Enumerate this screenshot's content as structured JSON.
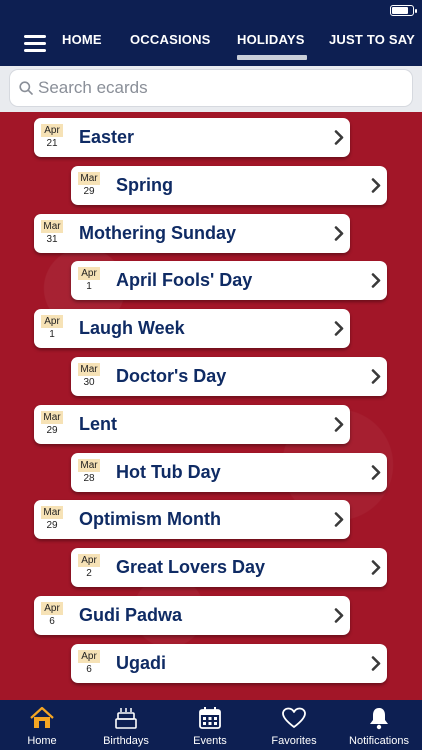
{
  "nav": {
    "tabs": [
      {
        "label": "HOME"
      },
      {
        "label": "OCCASIONS"
      },
      {
        "label": "HOLIDAYS",
        "active": true
      },
      {
        "label": "JUST TO SAY"
      }
    ]
  },
  "status": {
    "battery_level": 0.85
  },
  "search": {
    "placeholder": "Search ecards"
  },
  "cards": [
    {
      "month": "Apr",
      "day": "21",
      "title": "Easter"
    },
    {
      "month": "Mar",
      "day": "29",
      "title": "Spring"
    },
    {
      "month": "Mar",
      "day": "31",
      "title": "Mothering Sunday"
    },
    {
      "month": "Apr",
      "day": "1",
      "title": "April Fools' Day"
    },
    {
      "month": "Apr",
      "day": "1",
      "title": "Laugh Week"
    },
    {
      "month": "Mar",
      "day": "30",
      "title": "Doctor's Day"
    },
    {
      "month": "Mar",
      "day": "29",
      "title": "Lent"
    },
    {
      "month": "Mar",
      "day": "28",
      "title": "Hot Tub Day"
    },
    {
      "month": "Mar",
      "day": "29",
      "title": "Optimism Month"
    },
    {
      "month": "Apr",
      "day": "2",
      "title": "Great Lovers Day"
    },
    {
      "month": "Apr",
      "day": "6",
      "title": "Gudi Padwa"
    },
    {
      "month": "Apr",
      "day": "6",
      "title": "Ugadi"
    }
  ],
  "tabbar": [
    {
      "label": "Home",
      "icon": "home-icon",
      "active": true
    },
    {
      "label": "Birthdays",
      "icon": "cake-icon"
    },
    {
      "label": "Events",
      "icon": "calendar-icon"
    },
    {
      "label": "Favorites",
      "icon": "heart-icon"
    },
    {
      "label": "Notifications",
      "icon": "bell-icon"
    }
  ],
  "colors": {
    "header_bg": "#0d1f52",
    "content_bg": "#a21628",
    "title_text": "#0f2b64",
    "date_month_bg": "#f6e2b6",
    "home_icon_active": "#f5a623"
  }
}
